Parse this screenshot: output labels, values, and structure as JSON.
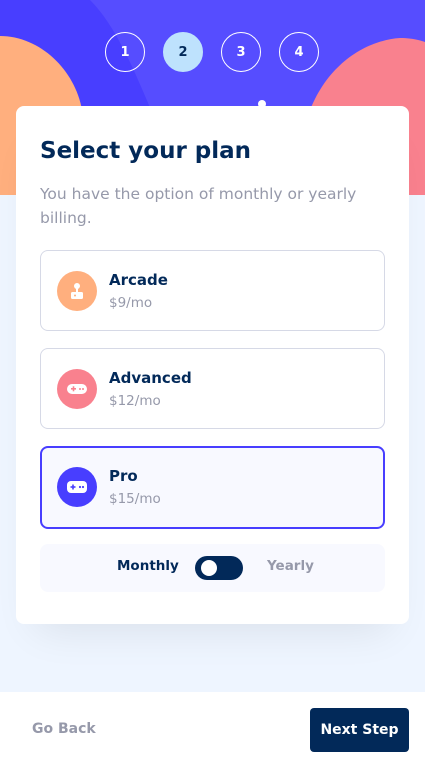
{
  "steps": [
    "1",
    "2",
    "3",
    "4"
  ],
  "active_step": 2,
  "plan_step": {
    "title": "Select your plan",
    "subtitle": "You have the option of monthly or yearly billing.",
    "plans": [
      {
        "name": "Arcade",
        "price": "$9/mo",
        "icon": "arcade-icon",
        "icon_color": "#ffaf7e",
        "selected": false
      },
      {
        "name": "Advanced",
        "price": "$12/mo",
        "icon": "gamepad-icon",
        "icon_color": "#f9818e",
        "selected": false
      },
      {
        "name": "Pro",
        "price": "$15/mo",
        "icon": "controller-icon",
        "icon_color": "#483eff",
        "selected": true
      }
    ],
    "billing": {
      "monthly_label": "Monthly",
      "yearly_label": "Yearly",
      "selected": "Monthly"
    }
  },
  "footer": {
    "back_label": "Go Back",
    "next_label": "Next Step"
  },
  "colors": {
    "accent": "#483eff",
    "marine_blue": "#022959",
    "grey": "#9699aa",
    "light_blue": "#bee2fd",
    "background": "#eef5ff"
  }
}
